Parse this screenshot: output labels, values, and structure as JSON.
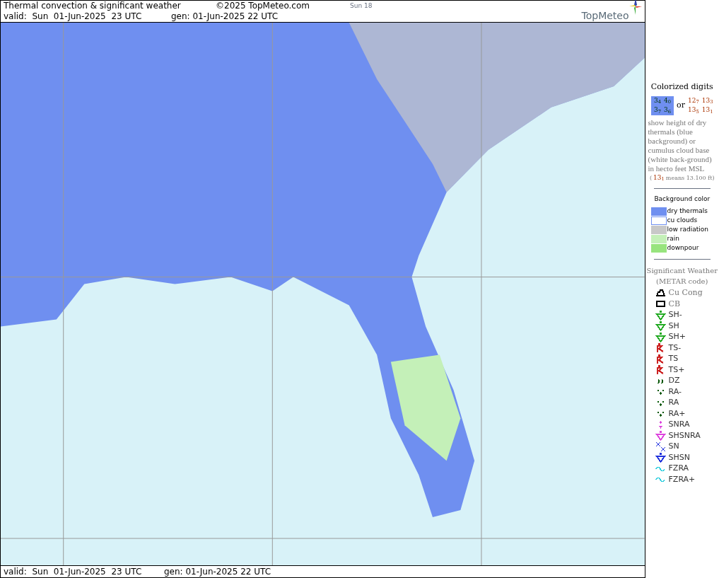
{
  "header": {
    "title": "Thermal convection & significant weather",
    "copyright": "©2025 TopMeteo.com",
    "day": "Sun 18",
    "valid": "valid:  Sun  01-Jun-2025  23 UTC",
    "gen": "gen: 01-Jun-2025 22 UTC",
    "logo": "TopMeteo"
  },
  "footer": {
    "valid": "valid:  Sun  01-Jun-2025  23 UTC",
    "gen": "gen: 01-Jun-2025 22 UTC"
  },
  "legend": {
    "digits": {
      "title": "Colorized digits",
      "dry_samples": [
        "3$_{4}$",
        "4$_{0}$",
        "3$_{7}$",
        "3$_{6}$"
      ],
      "or": "or",
      "cloud_samples": [
        "12$_{7}$",
        "13$_{3}$",
        "13$_{5}$",
        "13$_{1}$"
      ],
      "description": "show height of dry thermals (blue background) or cumulus cloud base (white back-ground) in hecto feet MSL",
      "example_prefix": "(",
      "example_value": "13$_{1}$",
      "example_suffix": "means 13.100 ft)"
    },
    "background": {
      "title": "Background color",
      "items": [
        {
          "label": "dry thermals",
          "color": "#6f8ff0"
        },
        {
          "label": "cu clouds",
          "color": "#ffffff"
        },
        {
          "label": "low radiation",
          "color": "#c8c8c8"
        },
        {
          "label": "rain",
          "color": "#c4f0b8"
        },
        {
          "label": "downpour",
          "color": "#98e47e"
        }
      ]
    },
    "weather": {
      "title": "Significant Weather",
      "subtitle": "(METAR code)",
      "items": [
        {
          "label": "Cu Cong",
          "kind": "cu_cong",
          "color": "#000000"
        },
        {
          "label": "CB",
          "kind": "cb",
          "color": "#000000"
        },
        {
          "label": "SH-",
          "kind": "shower",
          "color": "#22aa22"
        },
        {
          "label": "SH",
          "kind": "shower",
          "color": "#22aa22"
        },
        {
          "label": "SH+",
          "kind": "shower",
          "color": "#22aa22"
        },
        {
          "label": "TS-",
          "kind": "thunder",
          "color": "#cc2222"
        },
        {
          "label": "TS",
          "kind": "thunder",
          "color": "#cc2222"
        },
        {
          "label": "TS+",
          "kind": "thunder",
          "color": "#cc2222"
        },
        {
          "label": "DZ",
          "kind": "drizzle",
          "color": "#005500"
        },
        {
          "label": "RA-",
          "kind": "rain",
          "color": "#005500"
        },
        {
          "label": "RA",
          "kind": "rain",
          "color": "#005500"
        },
        {
          "label": "RA+",
          "kind": "rain",
          "color": "#005500"
        },
        {
          "label": "SNRA",
          "kind": "snow_rain",
          "color": "#dd44dd"
        },
        {
          "label": "SHSNRA",
          "kind": "shower",
          "color": "#dd44dd"
        },
        {
          "label": "SN",
          "kind": "snow",
          "color": "#2233dd"
        },
        {
          "label": "SHSN",
          "kind": "shower",
          "color": "#2233dd"
        },
        {
          "label": "FZRA",
          "kind": "freezing_rain",
          "color": "#22ccdd"
        },
        {
          "label": "FZRA+",
          "kind": "freezing_rain",
          "color": "#22ccdd"
        }
      ]
    }
  }
}
